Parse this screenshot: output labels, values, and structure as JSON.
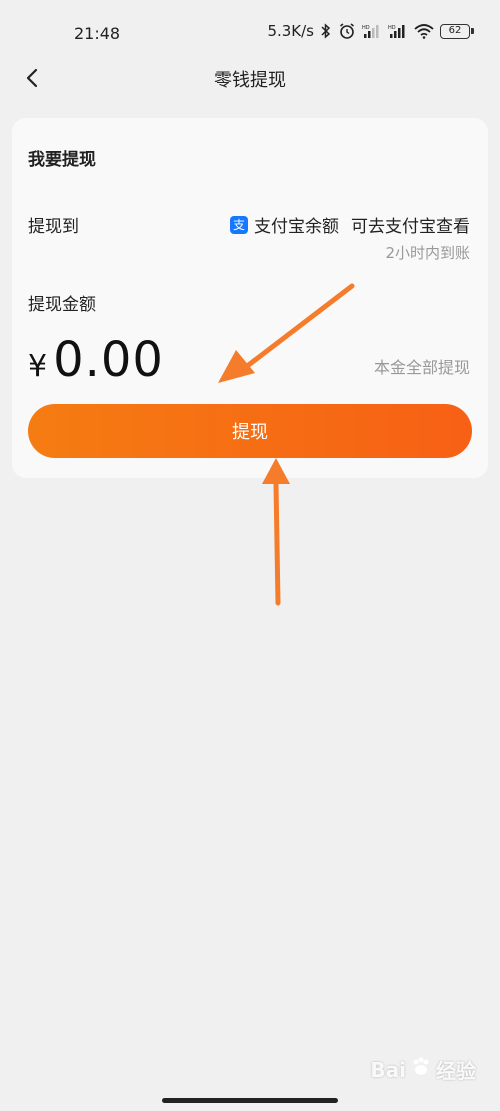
{
  "status_bar": {
    "time": "21:48",
    "net_speed": "5.3K/s",
    "battery": "62",
    "icons": [
      "bluetooth-icon",
      "alarm-icon",
      "signal-hd-icon",
      "signal-hd-icon",
      "wifi-icon",
      "battery-icon"
    ]
  },
  "nav": {
    "back_icon": "chevron-left-icon",
    "title": "零钱提现"
  },
  "card": {
    "title": "我要提现",
    "to_label": "提现到",
    "destination_icon": "alipay-icon",
    "destination_icon_glyph": "支",
    "destination": "支付宝余额",
    "view_link": "可去支付宝查看",
    "arrival_note": "2小时内到账",
    "amount_label": "提现金额",
    "currency": "¥",
    "amount": "0.00",
    "withdraw_all": "本金全部提现",
    "button_label": "提现"
  },
  "annotations": {
    "color": "#f57c2a",
    "icons": [
      "arrow-annotation-icon",
      "arrow-annotation-icon"
    ]
  },
  "watermark": {
    "logo_text": "Bai",
    "text": "经验"
  },
  "colors": {
    "accent_start": "#f57c12",
    "accent_end": "#f76015",
    "alipay": "#1677ff"
  }
}
